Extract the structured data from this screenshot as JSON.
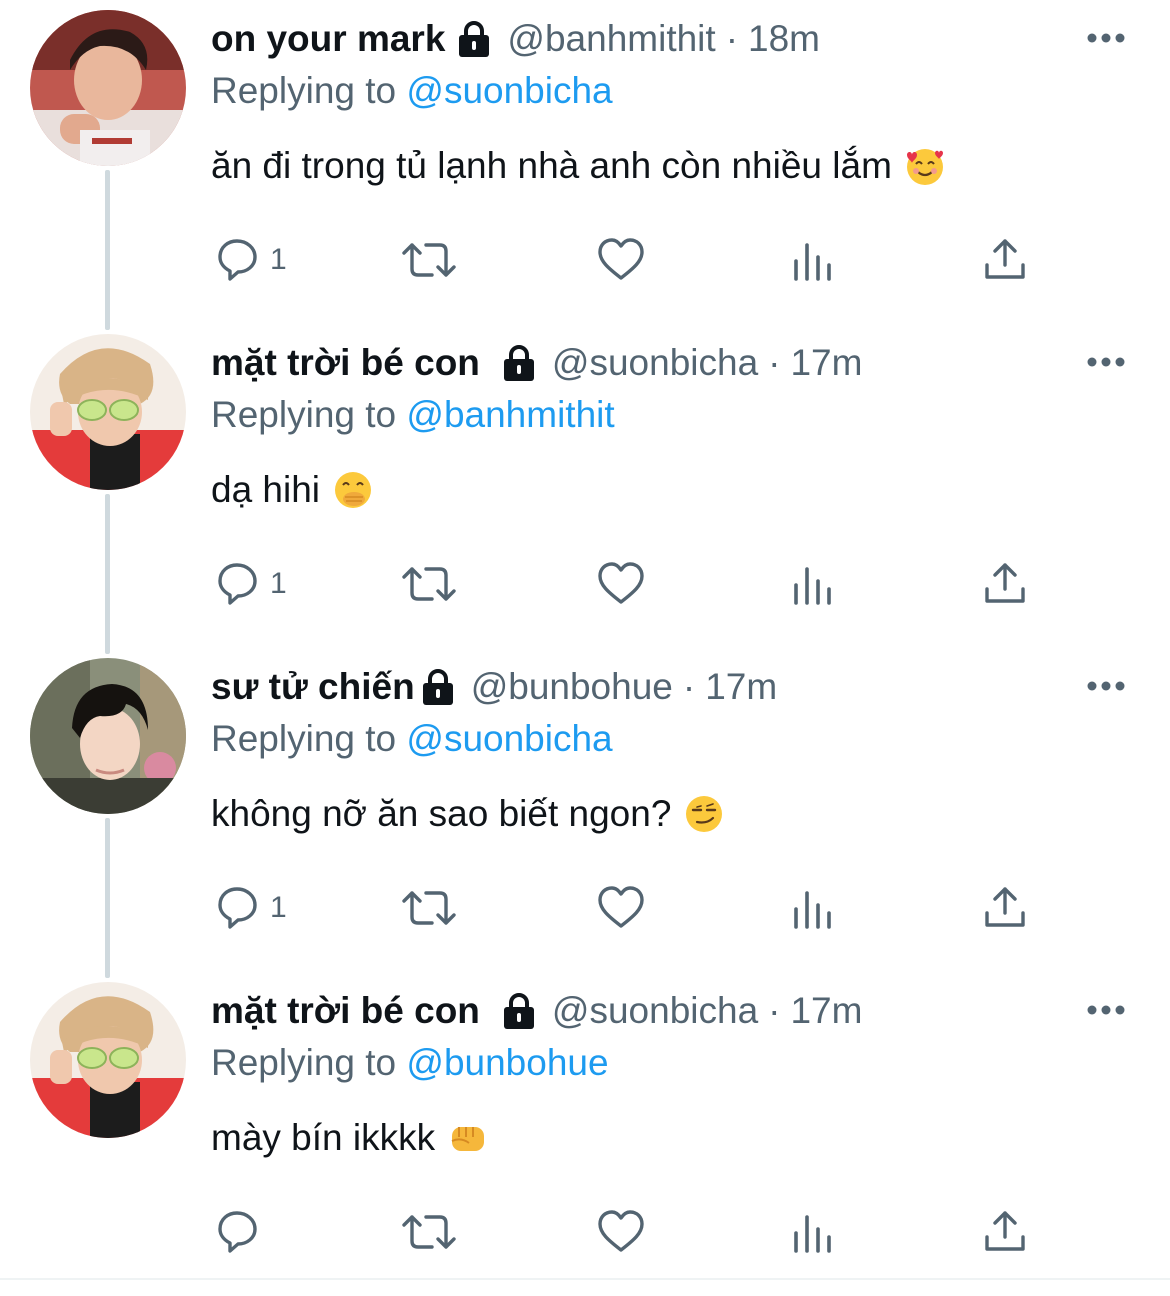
{
  "tweets": [
    {
      "display_name": "on your mark",
      "handle": "@banhmithit",
      "dot": "·",
      "time": "18m",
      "replying_label": "Replying to",
      "replying_to": "@suonbicha",
      "text": "ăn đi trong tủ lạnh nhà anh còn nhiều lắm",
      "emoji": "smiling-face-with-hearts",
      "reply_count": "1"
    },
    {
      "display_name": "mặt trời bé con",
      "handle": "@suonbicha",
      "dot": "·",
      "time": "17m",
      "replying_label": "Replying to",
      "replying_to": "@banhmithit",
      "text": "dạ hihi",
      "emoji": "face-with-hand-over-mouth",
      "reply_count": "1"
    },
    {
      "display_name": "sư tử chiến",
      "handle": "@bunbohue",
      "dot": "·",
      "time": "17m",
      "replying_label": "Replying to",
      "replying_to": "@suonbicha",
      "text": "không nỡ ăn sao biết ngon?",
      "emoji": "smirking-face",
      "reply_count": "1"
    },
    {
      "display_name": "mặt trời bé con",
      "handle": "@suonbicha",
      "dot": "·",
      "time": "17m",
      "replying_label": "Replying to",
      "replying_to": "@bunbohue",
      "text": "mày bín ikkkk",
      "emoji": "oncoming-fist",
      "reply_count": ""
    }
  ],
  "colors": {
    "text": "#0f1419",
    "secondary": "#536471",
    "link": "#1d9bf0",
    "thread_line": "#cfd9de"
  },
  "icons": {
    "lock": "lock-icon",
    "more": "more-icon",
    "reply": "reply-icon",
    "retweet": "retweet-icon",
    "like": "heart-icon",
    "views": "views-icon",
    "share": "share-icon"
  }
}
